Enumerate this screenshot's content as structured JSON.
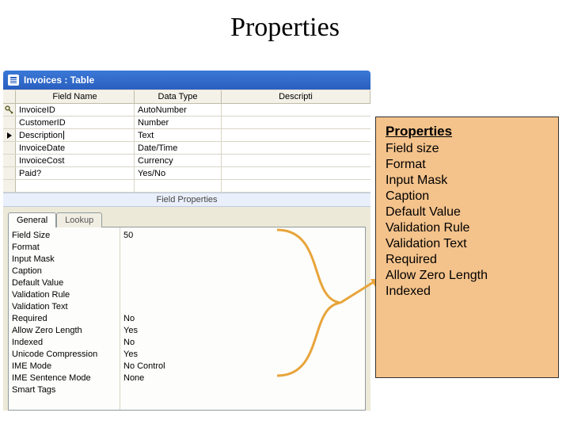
{
  "slide": {
    "title": "Properties"
  },
  "window": {
    "title": "Invoices : Table"
  },
  "grid": {
    "headers": {
      "name": "Field Name",
      "type": "Data Type",
      "desc": "Descripti"
    },
    "fields": [
      {
        "sel": "key",
        "name": "InvoiceID",
        "type": "AutoNumber"
      },
      {
        "sel": "",
        "name": "CustomerID",
        "type": "Number"
      },
      {
        "sel": "current",
        "name": "Description",
        "type": "Text"
      },
      {
        "sel": "",
        "name": "InvoiceDate",
        "type": "Date/Time"
      },
      {
        "sel": "",
        "name": "InvoiceCost",
        "type": "Currency"
      },
      {
        "sel": "",
        "name": "Paid?",
        "type": "Yes/No"
      }
    ]
  },
  "fieldprops": {
    "bar": "Field Properties",
    "tabs": {
      "general": "General",
      "lookup": "Lookup"
    },
    "rows": [
      {
        "name": "Field Size",
        "value": "50"
      },
      {
        "name": "Format",
        "value": ""
      },
      {
        "name": "Input Mask",
        "value": ""
      },
      {
        "name": "Caption",
        "value": ""
      },
      {
        "name": "Default Value",
        "value": ""
      },
      {
        "name": "Validation Rule",
        "value": ""
      },
      {
        "name": "Validation Text",
        "value": ""
      },
      {
        "name": "Required",
        "value": "No"
      },
      {
        "name": "Allow Zero Length",
        "value": "Yes"
      },
      {
        "name": "Indexed",
        "value": "No"
      },
      {
        "name": "Unicode Compression",
        "value": "Yes"
      },
      {
        "name": "IME Mode",
        "value": "No Control"
      },
      {
        "name": "IME Sentence Mode",
        "value": "None"
      },
      {
        "name": "Smart Tags",
        "value": ""
      }
    ]
  },
  "callout": {
    "title": "Properties",
    "items": [
      "Field size",
      "Format",
      "Input Mask",
      "Caption",
      "Default Value",
      "Validation Rule",
      "Validation Text",
      "Required",
      "Allow Zero Length",
      "Indexed"
    ]
  }
}
